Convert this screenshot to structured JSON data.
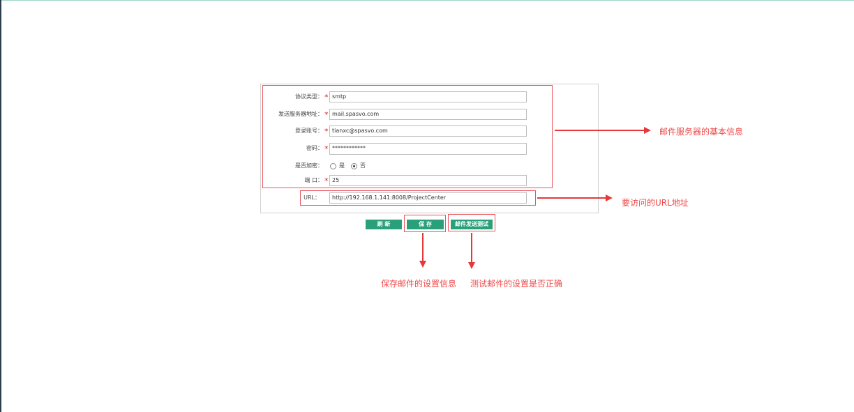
{
  "form": {
    "protocol": {
      "label": "协议类型：",
      "value": "smtp"
    },
    "server": {
      "label": "发送服务器地址：",
      "value": "mail.spasvo.com"
    },
    "account": {
      "label": "登录账号：",
      "value": "tianxc@spasvo.com"
    },
    "password": {
      "label": "密码：",
      "value": "************"
    },
    "encrypt": {
      "label": "是否加密：",
      "yes": "是",
      "no": "否",
      "selected": "否"
    },
    "port": {
      "label": "端 口：",
      "value": "25"
    },
    "url": {
      "label": "URL：",
      "value": "http://192.168.1.141:8008/ProjectCenter"
    },
    "required_mark": "*"
  },
  "buttons": {
    "refresh": "刷 新",
    "save": "保 存",
    "test": "邮件发送测试"
  },
  "annotations": {
    "server_info": "邮件服务器的基本信息",
    "url_info": "要访问的URL地址",
    "save_info": "保存邮件的设置信息",
    "test_info": "测试邮件的设置是否正确"
  },
  "colors": {
    "button": "#2aa07a",
    "annotation": "#f04848",
    "required": "#e02020"
  }
}
